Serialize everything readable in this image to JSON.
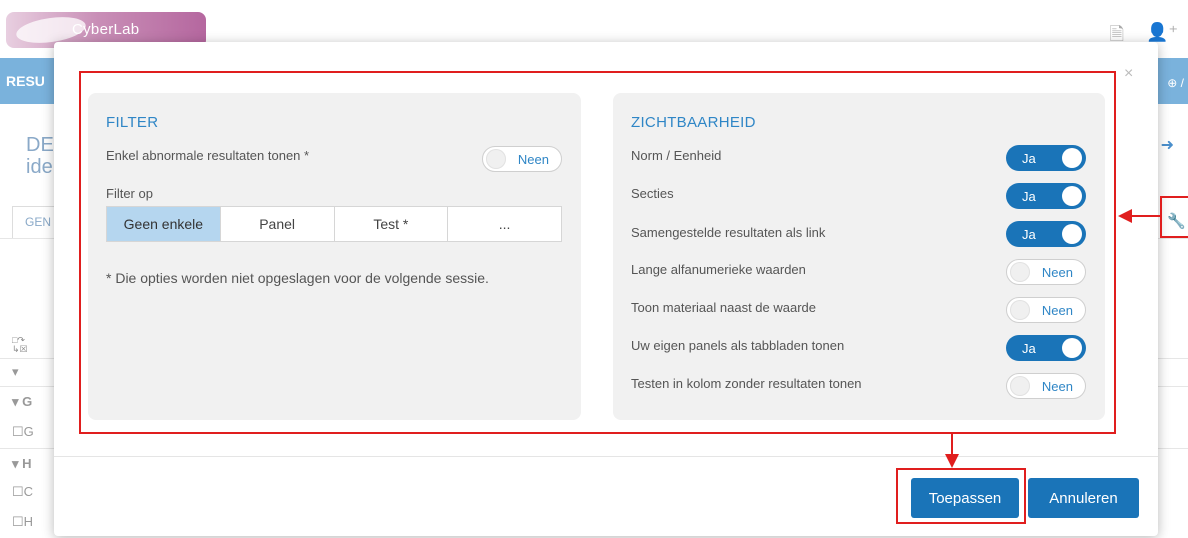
{
  "app": {
    "logo_text": "CyberLab",
    "nav_label": "RESU",
    "page_title_line1": "DE",
    "page_title_line2": "ide",
    "tab_label": "GEN",
    "rows": [
      "G",
      "G",
      "H",
      "C",
      "H"
    ]
  },
  "modal": {
    "close_icon": "×",
    "filter": {
      "title": "FILTER",
      "abnormal_label": "Enkel abnormale resultaten tonen *",
      "abnormal_toggle": "Neen",
      "filter_on_label": "Filter op",
      "options": [
        "Geen enkele",
        "Panel",
        "Test *",
        "..."
      ],
      "selected": "Geen enkele",
      "note": "* Die opties worden niet opgeslagen voor de volgende sessie."
    },
    "visibility": {
      "title": "ZICHTBAARHEID",
      "items": [
        {
          "label": "Norm / Eenheid",
          "value": "Ja"
        },
        {
          "label": "Secties",
          "value": "Ja"
        },
        {
          "label": "Samengestelde resultaten als link",
          "value": "Ja"
        },
        {
          "label": "Lange alfanumerieke waarden",
          "value": "Neen"
        },
        {
          "label": "Toon materiaal naast de waarde",
          "value": "Neen"
        },
        {
          "label": "Uw eigen panels als tabbladen tonen",
          "value": "Ja"
        },
        {
          "label": "Testen in kolom zonder resultaten tonen",
          "value": "Neen"
        }
      ]
    },
    "buttons": {
      "apply": "Toepassen",
      "cancel": "Annuleren"
    }
  },
  "colors": {
    "accent": "#1a74b8",
    "title_blue": "#2f86c6",
    "annotation_red": "#e01e1e"
  }
}
